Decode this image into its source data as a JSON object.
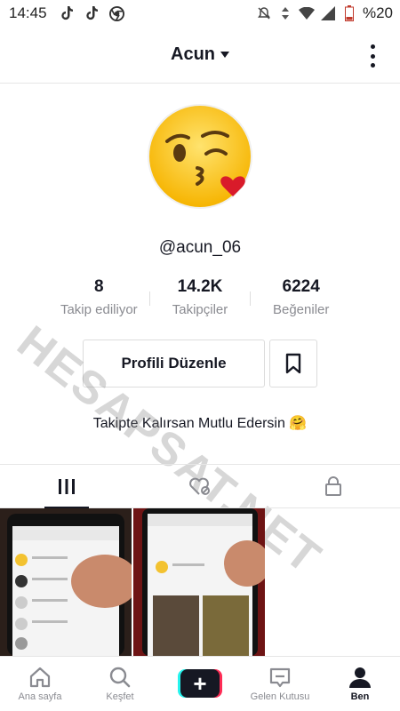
{
  "status_bar": {
    "time": "14:45",
    "battery": "%20",
    "icons_left": [
      "tiktok-icon",
      "tiktok-icon",
      "chrome-icon"
    ],
    "icons_right": [
      "mute-icon",
      "data-arrows-icon",
      "wifi-icon",
      "signal-icon",
      "battery-icon"
    ]
  },
  "header": {
    "username": "Acun",
    "menu_icon": "more-vertical-icon"
  },
  "profile": {
    "handle": "@acun_06",
    "avatar": "kissing-face-emoji",
    "stats": [
      {
        "value": "8",
        "label": "Takip ediliyor"
      },
      {
        "value": "14.2K",
        "label": "Takipçiler"
      },
      {
        "value": "6224",
        "label": "Beğeniler"
      }
    ],
    "edit_button": "Profili Düzenle",
    "bio": "Takipte Kalırsan Mutlu Edersin 🤗"
  },
  "watermark": "HESAPSAT.NET",
  "tabs": [
    {
      "icon": "grid-icon",
      "active": true
    },
    {
      "icon": "liked-heart-icon",
      "active": false
    },
    {
      "icon": "lock-icon",
      "active": false
    }
  ],
  "videos": [
    {
      "thumbnail": "phone-screenshot-1"
    },
    {
      "thumbnail": "phone-screenshot-2"
    }
  ],
  "bottom_nav": [
    {
      "label": "Ana sayfa",
      "icon": "home-icon"
    },
    {
      "label": "Keşfet",
      "icon": "search-icon"
    },
    {
      "label": "",
      "icon": "plus-icon"
    },
    {
      "label": "Gelen Kutusu",
      "icon": "inbox-icon"
    },
    {
      "label": "Ben",
      "icon": "profile-icon",
      "active": true
    }
  ],
  "colors": {
    "text": "#161823",
    "secondary": "#8a8b91",
    "accent_cyan": "#25f4ee",
    "accent_red": "#fe2c55"
  }
}
